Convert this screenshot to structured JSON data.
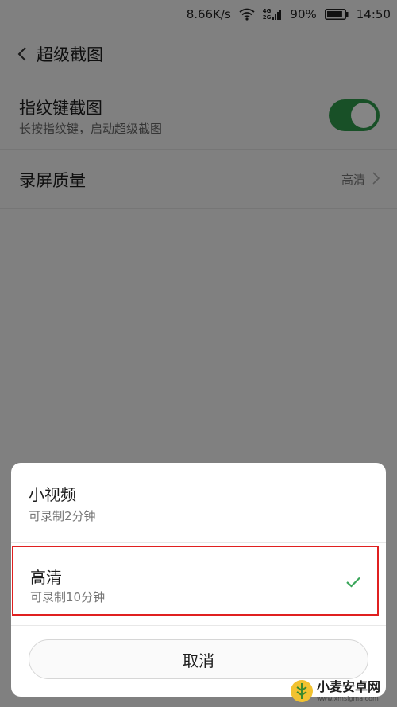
{
  "status_bar": {
    "net_speed": "8.66K/s",
    "network_types": [
      "4G",
      "2G"
    ],
    "battery_percent": "90%",
    "battery_level": 0.9,
    "time": "14:50"
  },
  "app_bar": {
    "title": "超级截图",
    "back_icon": "chevron-left-icon"
  },
  "settings": {
    "fingerprint": {
      "title": "指纹键截图",
      "subtitle": "长按指纹键，启动超级截图",
      "enabled": true
    },
    "record_quality": {
      "title": "录屏质量",
      "value": "高清"
    }
  },
  "sheet": {
    "options": [
      {
        "title": "小视频",
        "subtitle": "可录制2分钟",
        "selected": false
      },
      {
        "title": "高清",
        "subtitle": "可录制10分钟",
        "selected": true
      }
    ],
    "cancel_label": "取消"
  },
  "watermark": {
    "main": "小麦安卓网",
    "url": "www.xmsigma.com"
  },
  "colors": {
    "accent_green": "#2e9a4b",
    "highlight_red": "#e02020",
    "check_green": "#3aa65a"
  }
}
